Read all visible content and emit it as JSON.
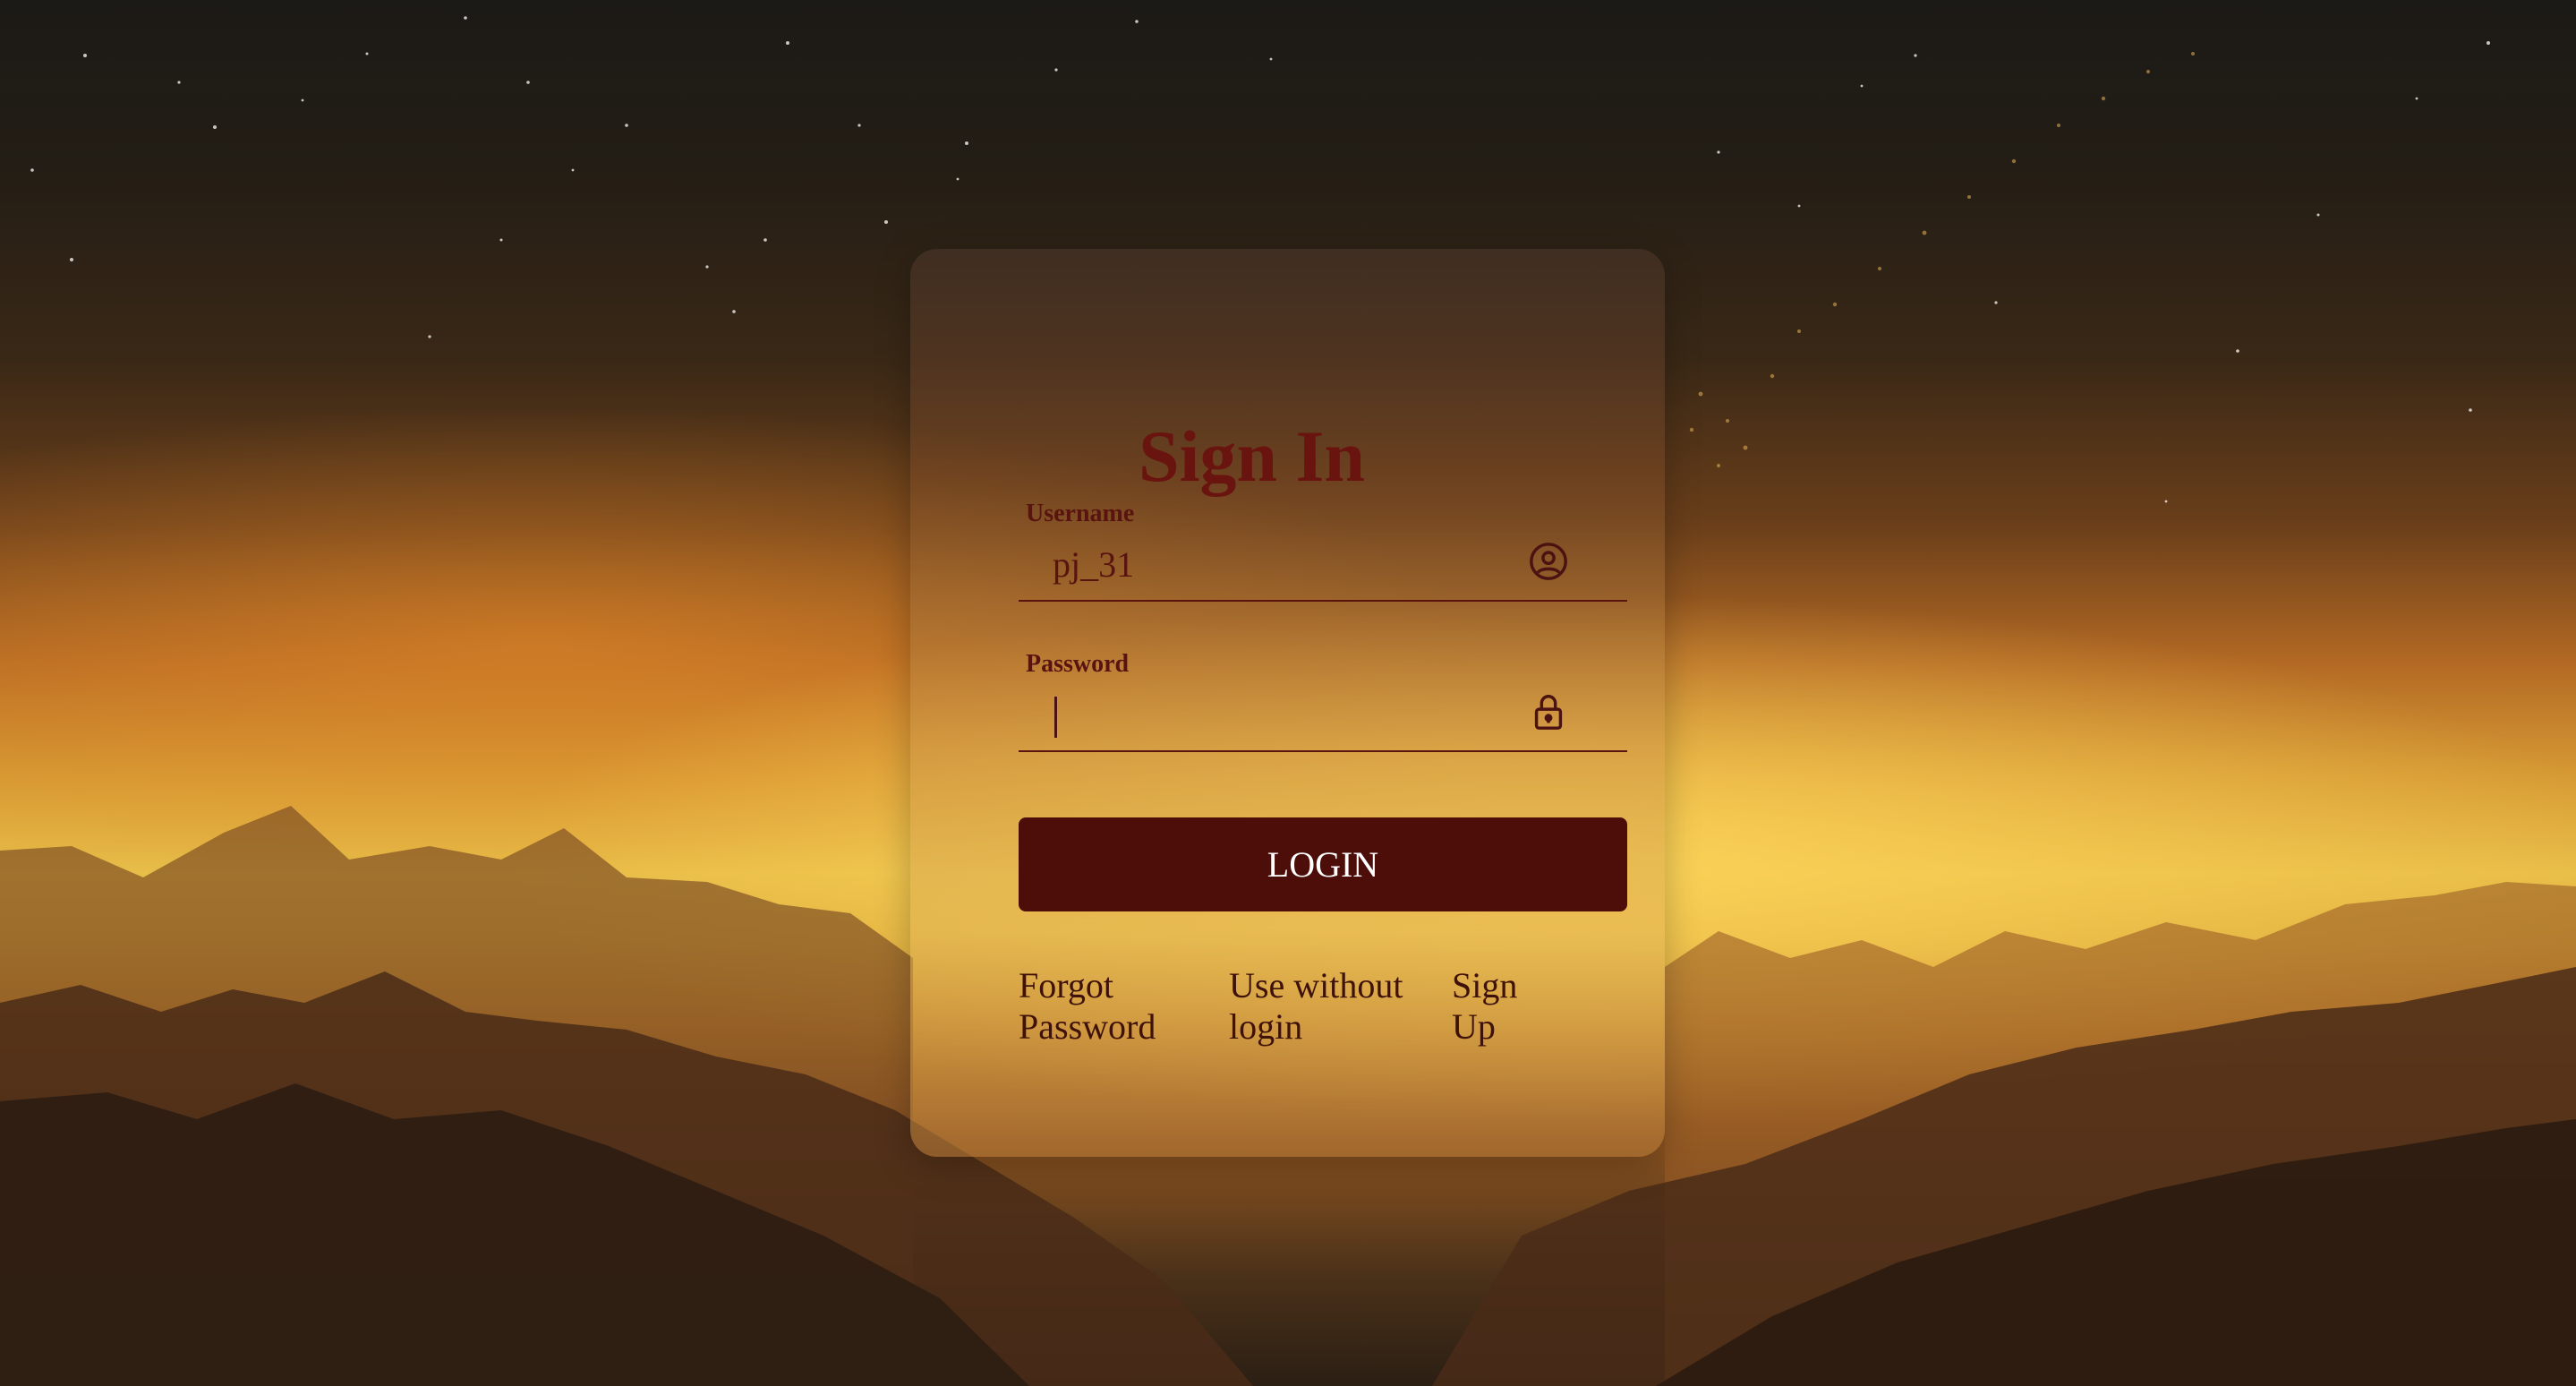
{
  "form": {
    "title": "Sign In",
    "username": {
      "label": "Username",
      "value": "pj_31",
      "icon": "user-circle-icon"
    },
    "password": {
      "label": "Password",
      "value": "",
      "icon": "lock-icon"
    },
    "login_button_label": "LOGIN",
    "links": {
      "forgot_password_line1": "Forgot",
      "forgot_password_line2": "Password",
      "use_without_login_line1": "Use without",
      "use_without_login_line2": "login",
      "sign_up_line1": "Sign",
      "sign_up_line2": "Up"
    }
  },
  "colors": {
    "title": "#6a1410",
    "button_bg": "#4d0d08",
    "button_text": "#ffffff",
    "link_text": "#3e1208"
  }
}
